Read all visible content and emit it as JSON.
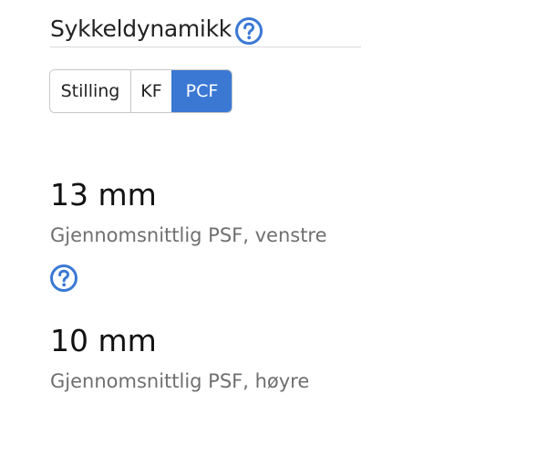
{
  "section": {
    "title": "Sykkeldynamikk",
    "help_icon": "question-circle-icon"
  },
  "tabs": [
    {
      "label": "Stilling",
      "active": false
    },
    {
      "label": "KF",
      "active": false
    },
    {
      "label": "PCF",
      "active": true
    }
  ],
  "metrics": {
    "left": {
      "value": "13 mm",
      "label": "Gjennomsnittlig PSF, venstre"
    },
    "right": {
      "value": "10 mm",
      "label": "Gjennomsnittlig PSF, høyre"
    },
    "help_icon": "question-circle-icon"
  },
  "colors": {
    "accent": "#3a78d4",
    "label_gray": "#6f6f6f",
    "divider": "#d9d9d9"
  }
}
